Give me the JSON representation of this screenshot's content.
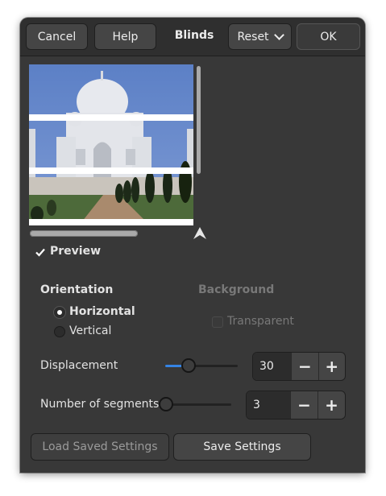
{
  "headerbar": {
    "cancel_label": "Cancel",
    "help_label": "Help",
    "title": "Blinds",
    "reset_label": "Reset",
    "ok_label": "OK"
  },
  "preview": {
    "image_subject": "Taj Mahal with blinds effect",
    "checkbox_label": "Preview",
    "checked": true
  },
  "orientation": {
    "heading": "Orientation",
    "options": [
      {
        "label": "Horizontal",
        "selected": true
      },
      {
        "label": "Vertical",
        "selected": false
      }
    ]
  },
  "background": {
    "heading": "Background",
    "transparent_label": "Transparent",
    "transparent_checked": false,
    "enabled": false
  },
  "displacement": {
    "label": "Displacement",
    "value": "30",
    "min": 1,
    "max": 90
  },
  "segments": {
    "label": "Number of segments",
    "value": "3",
    "min": 1,
    "max": 24
  },
  "spin_buttons": {
    "minus": "−",
    "plus": "+"
  },
  "footer": {
    "load_label": "Load Saved Settings",
    "save_label": "Save Settings"
  },
  "colors": {
    "dialog_bg": "#383838",
    "header_bg": "#2f2f2f",
    "accent": "#3584e4"
  }
}
